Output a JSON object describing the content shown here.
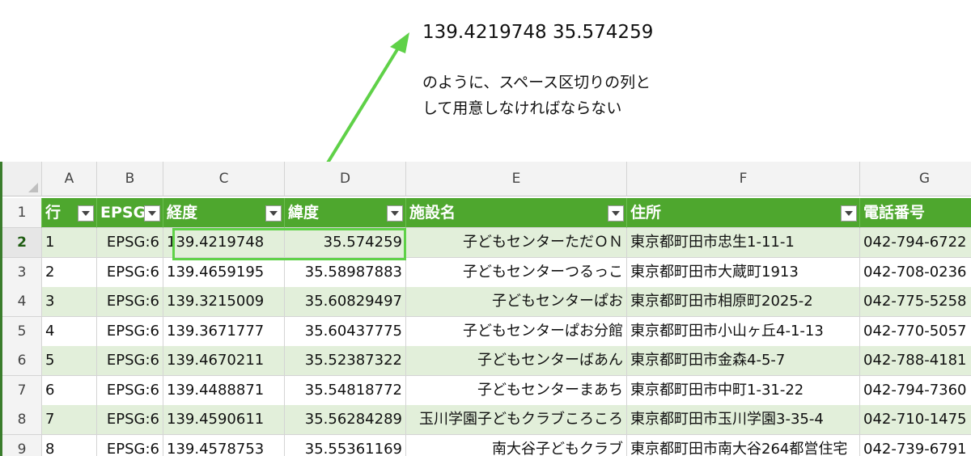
{
  "annotation": {
    "value_text": "139.4219748 35.574259",
    "note_line1": "のように、スペース区切りの列と",
    "note_line2": "して用意しなければならない"
  },
  "colors": {
    "header_green": "#4ea72e",
    "band_green": "#e2efda",
    "arrow_green": "#5fd148"
  },
  "sheet": {
    "column_letters": [
      "A",
      "B",
      "C",
      "D",
      "E",
      "F",
      "G"
    ],
    "row_numbers": [
      "1",
      "2",
      "3",
      "4",
      "5",
      "6",
      "7",
      "8",
      "9"
    ],
    "headers": [
      "行",
      "EPSG",
      "経度",
      "緯度",
      "施設名",
      "住所",
      "電話番号"
    ],
    "rows": [
      [
        "1",
        "EPSG:6",
        "139.4219748",
        "35.574259",
        "子どもセンターただＯＮ",
        "東京都町田市忠生1-11-1",
        "042-794-6722"
      ],
      [
        "2",
        "EPSG:6",
        "139.4659195",
        "35.58987883",
        "子どもセンターつるっこ",
        "東京都町田市大蔵町1913",
        "042-708-0236"
      ],
      [
        "3",
        "EPSG:6",
        "139.3215009",
        "35.60829497",
        "子どもセンターぱお",
        "東京都町田市相原町2025-2",
        "042-775-5258"
      ],
      [
        "4",
        "EPSG:6",
        "139.3671777",
        "35.60437775",
        "子どもセンターぱお分館",
        "東京都町田市小山ヶ丘4-1-13",
        "042-770-5057"
      ],
      [
        "5",
        "EPSG:6",
        "139.4670211",
        "35.52387322",
        "子どもセンターばあん",
        "東京都町田市金森4-5-7",
        "042-788-4181"
      ],
      [
        "6",
        "EPSG:6",
        "139.4488871",
        "35.54818772",
        "子どもセンターまあち",
        "東京都町田市中町1-31-22",
        "042-794-7360"
      ],
      [
        "7",
        "EPSG:6",
        "139.4590611",
        "35.56284289",
        "玉川学園子どもクラブころころ",
        "東京都町田市玉川学園3-35-4",
        "042-710-1475"
      ],
      [
        "8",
        "EPSG:6",
        "139.4578753",
        "35.55361169",
        "南大谷子どもクラブ",
        "東京都町田市南大谷264都営住宅",
        "042-739-6791"
      ]
    ]
  }
}
